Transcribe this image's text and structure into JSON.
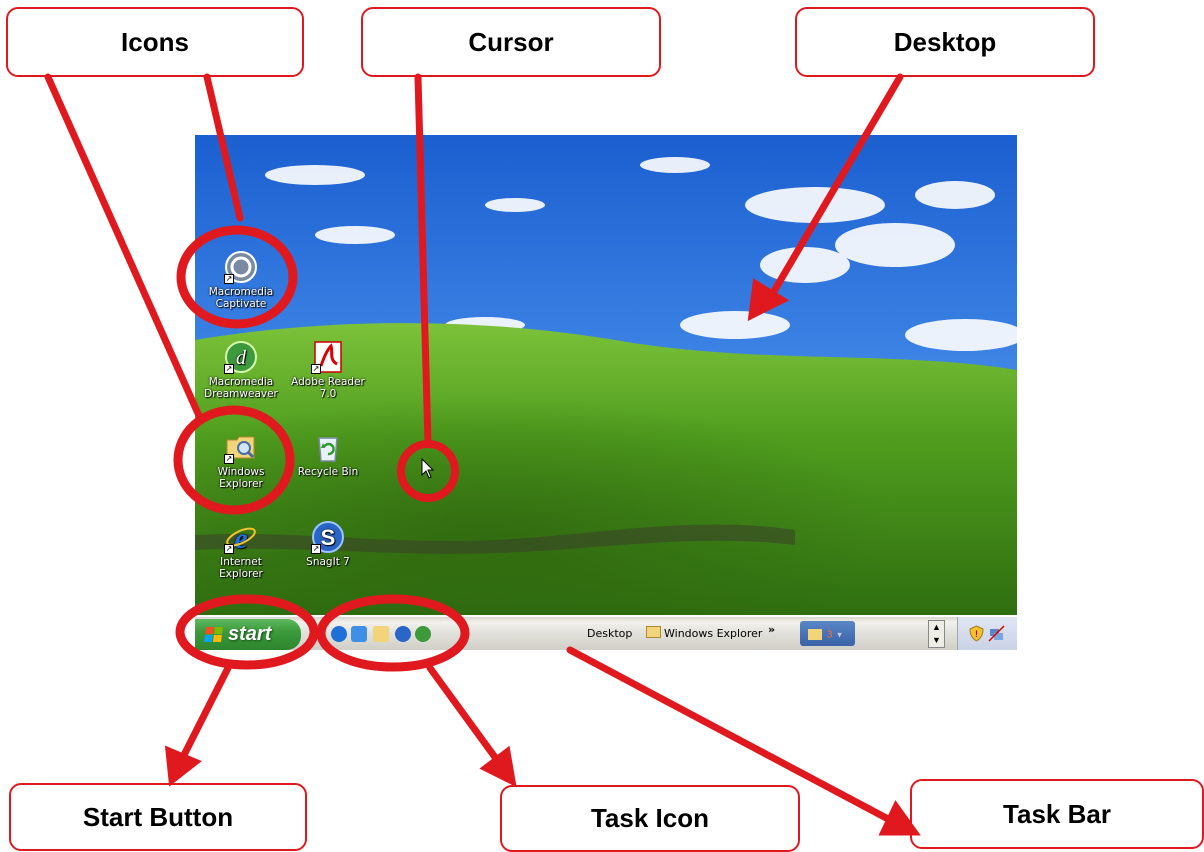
{
  "callouts": {
    "icons": "Icons",
    "cursor": "Cursor",
    "desktop": "Desktop",
    "start_button": "Start Button",
    "task_icon": "Task Icon",
    "task_bar": "Task Bar"
  },
  "desktop_icons": [
    {
      "label_line1": "Macromedia",
      "label_line2": "Captivate",
      "icon": "captivate-icon"
    },
    {
      "label_line1": "Macromedia",
      "label_line2": "Dreamweaver",
      "icon": "dreamweaver-icon"
    },
    {
      "label_line1": "Adobe Reader",
      "label_line2": "7.0",
      "icon": "adobe-reader-icon"
    },
    {
      "label_line1": "Windows",
      "label_line2": "Explorer",
      "icon": "windows-explorer-icon"
    },
    {
      "label_line1": "Recycle Bin",
      "label_line2": "",
      "icon": "recycle-bin-icon"
    },
    {
      "label_line1": "Internet",
      "label_line2": "Explorer",
      "icon": "internet-explorer-icon"
    },
    {
      "label_line1": "SnagIt 7",
      "label_line2": "",
      "icon": "snagit-icon"
    }
  ],
  "taskbar": {
    "start_label": "start",
    "quick_launch": [
      "internet-explorer-icon",
      "outlook-express-icon",
      "windows-explorer-icon",
      "snagit-icon",
      "dreamweaver-icon"
    ],
    "toolbar_desktop": "Desktop",
    "toolbar_explorer": "Windows Explorer",
    "chevron": "»",
    "group_count": "3"
  },
  "colors": {
    "annotation_red": "#e0191f",
    "start_green": "#3c9a3c",
    "sky_blue": "#2f6fd6",
    "grass_green": "#4e9a1c"
  }
}
